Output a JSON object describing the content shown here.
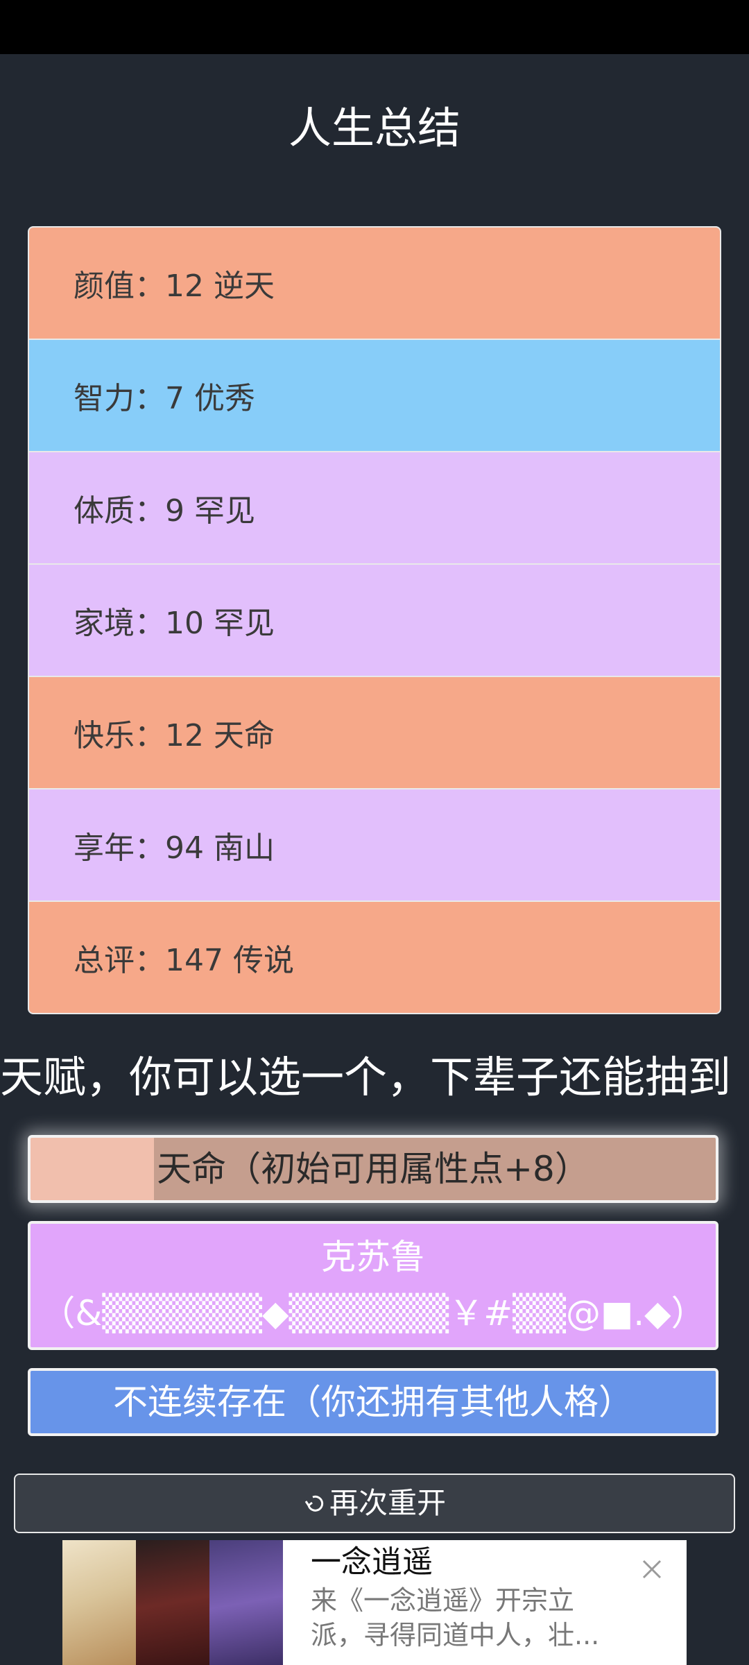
{
  "title": "人生总结",
  "stats": [
    {
      "label": "颜值：12 逆天",
      "tone": "orange"
    },
    {
      "label": "智力：7 优秀",
      "tone": "blue"
    },
    {
      "label": "体质：9 罕见",
      "tone": "purple"
    },
    {
      "label": "家境：10 罕见",
      "tone": "purple"
    },
    {
      "label": "快乐：12 天命",
      "tone": "orange"
    },
    {
      "label": "享年：94 南山",
      "tone": "purple"
    },
    {
      "label": "总评：147 传说",
      "tone": "orange"
    }
  ],
  "talent_heading": "天赋，你可以选一个，下辈子还能抽到",
  "talents": [
    {
      "label": "天命（初始可用属性点+8）"
    },
    {
      "name": "克苏鲁",
      "desc": "（&▒▒▒▒▒▒◆▒▒▒▒▒▒￥#▒▒@■.◆）"
    },
    {
      "label": "不连续存在（你还拥有其他人格）"
    }
  ],
  "restart_label": "再次重开",
  "ad": {
    "title": "一念逍遥",
    "desc": "来《一念逍遥》开宗立派，寻得同道中人，壮...",
    "close_icon": "close-icon"
  },
  "colors": {
    "background": "#222831",
    "orange": "#f6a889",
    "blue": "#87cdf9",
    "purple": "#e2bffc",
    "talent_blue": "#6794e9"
  }
}
